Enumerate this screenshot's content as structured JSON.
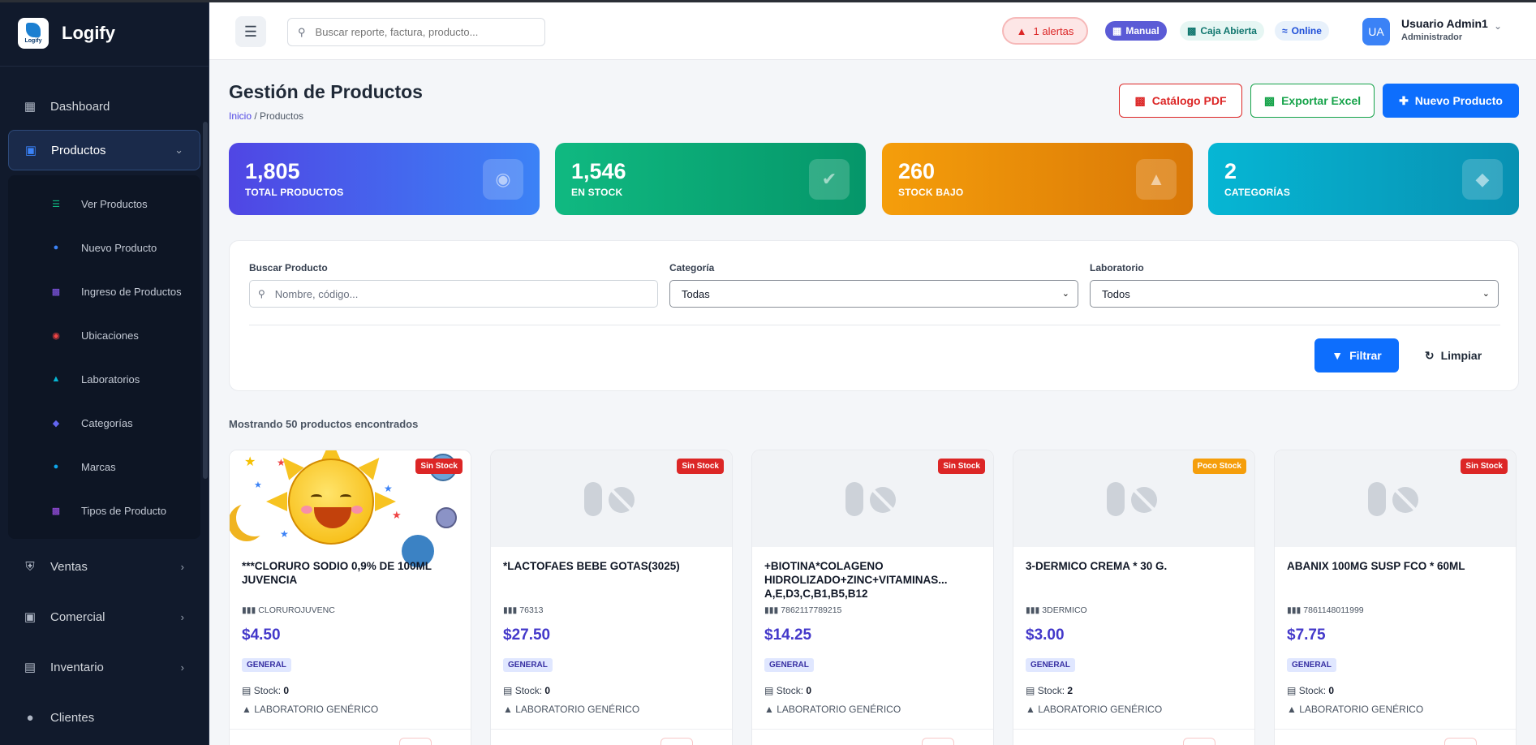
{
  "brand": {
    "name": "Logify",
    "logo_text": "Logify"
  },
  "sidebar": {
    "items": [
      {
        "label": "Dashboard",
        "icon": "grid-icon"
      },
      {
        "label": "Productos",
        "icon": "box-icon",
        "active": true,
        "expanded": true
      }
    ],
    "submenu": [
      {
        "label": "Ver Productos",
        "icon": "list-icon",
        "color": "#10b981"
      },
      {
        "label": "Nuevo Producto",
        "icon": "plus-circle-icon",
        "color": "#3b82f6"
      },
      {
        "label": "Ingreso de Productos",
        "icon": "file-import-icon",
        "color": "#8b5cf6"
      },
      {
        "label": "Ubicaciones",
        "icon": "map-pin-icon",
        "color": "#ef4444"
      },
      {
        "label": "Laboratorios",
        "icon": "flask-icon",
        "color": "#06b6d4"
      },
      {
        "label": "Categorías",
        "icon": "tag-icon",
        "color": "#6366f1"
      },
      {
        "label": "Marcas",
        "icon": "copyright-icon",
        "color": "#0ea5e9"
      },
      {
        "label": "Tipos de Producto",
        "icon": "cubes-icon",
        "color": "#a855f7"
      }
    ],
    "items2": [
      {
        "label": "Ventas",
        "icon": "cart-icon"
      },
      {
        "label": "Comercial",
        "icon": "briefcase-icon"
      },
      {
        "label": "Inventario",
        "icon": "warehouse-icon"
      },
      {
        "label": "Clientes",
        "icon": "users-icon"
      }
    ]
  },
  "topbar": {
    "search_placeholder": "Buscar reporte, factura, producto...",
    "alerts": "1 alertas",
    "manual": "Manual",
    "caja": "Caja Abierta",
    "online": "Online",
    "user_initials": "UA",
    "user_name": "Usuario Admin1",
    "user_role": "Administrador"
  },
  "page": {
    "title": "Gestión de Productos",
    "breadcrumb_home": "Inicio",
    "breadcrumb_sep": " / ",
    "breadcrumb_current": "Productos",
    "btn_pdf": "Catálogo PDF",
    "btn_excel": "Exportar Excel",
    "btn_new": "Nuevo Producto"
  },
  "stats": [
    {
      "value": "1,805",
      "label": "TOTAL PRODUCTOS",
      "icon": "pills-icon"
    },
    {
      "value": "1,546",
      "label": "EN STOCK",
      "icon": "check-circle-icon"
    },
    {
      "value": "260",
      "label": "STOCK BAJO",
      "icon": "warning-icon"
    },
    {
      "value": "2",
      "label": "CATEGORÍAS",
      "icon": "tags-icon"
    }
  ],
  "filters": {
    "search_label": "Buscar Producto",
    "search_placeholder": "Nombre, código...",
    "category_label": "Categoría",
    "category_value": "Todas",
    "lab_label": "Laboratorio",
    "lab_value": "Todos",
    "btn_filter": "Filtrar",
    "btn_clear": "Limpiar"
  },
  "results_text": "Mostrando 50 productos encontrados",
  "products": [
    {
      "name": "***CLORURO SODIO 0,9% DE 100ML JUVENCIA",
      "code": "CLORUROJUVENC",
      "price": "$4.50",
      "category": "GENERAL",
      "stock_label": "Stock:",
      "stock": "0",
      "lab": "LABORATORIO GENÉRICO",
      "badge": "Sin Stock",
      "badge_color": "#dc2626",
      "image": "sun"
    },
    {
      "name": "*LACTOFAES BEBE GOTAS(3025)",
      "code": "76313",
      "price": "$27.50",
      "category": "GENERAL",
      "stock_label": "Stock:",
      "stock": "0",
      "lab": "LABORATORIO GENÉRICO",
      "badge": "Sin Stock",
      "badge_color": "#dc2626",
      "image": "placeholder"
    },
    {
      "name": "+BIOTINA*COLAGENO HIDROLIZADO+ZINC+VITAMINAS... A,E,D3,C,B1,B5,B12",
      "code": "7862117789215",
      "price": "$14.25",
      "category": "GENERAL",
      "stock_label": "Stock:",
      "stock": "0",
      "lab": "LABORATORIO GENÉRICO",
      "badge": "Sin Stock",
      "badge_color": "#dc2626",
      "image": "placeholder"
    },
    {
      "name": "3-DERMICO CREMA * 30 G.",
      "code": "3DERMICO",
      "price": "$3.00",
      "category": "GENERAL",
      "stock_label": "Stock:",
      "stock": "2",
      "lab": "LABORATORIO GENÉRICO",
      "badge": "Poco Stock",
      "badge_color": "#f59e0b",
      "image": "placeholder"
    },
    {
      "name": "ABANIX 100MG SUSP FCO * 60ML",
      "code": "7861148011999",
      "price": "$7.75",
      "category": "GENERAL",
      "stock_label": "Stock:",
      "stock": "0",
      "lab": "LABORATORIO GENÉRICO",
      "badge": "Sin Stock",
      "badge_color": "#dc2626",
      "image": "placeholder"
    }
  ]
}
